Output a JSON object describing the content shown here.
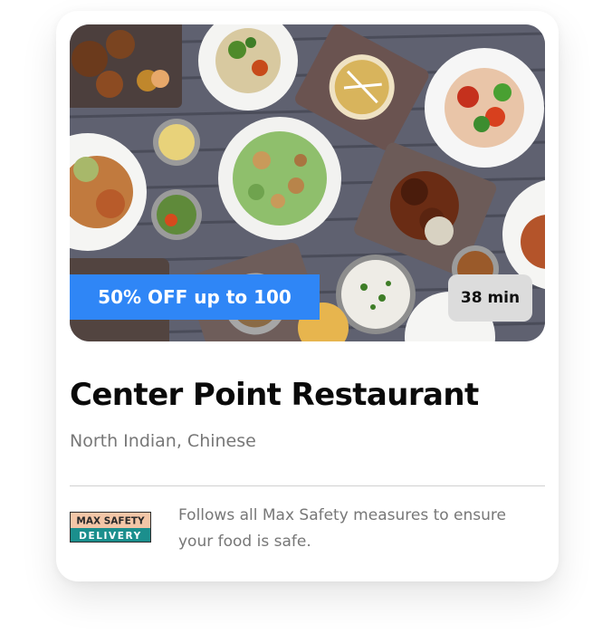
{
  "restaurant": {
    "name": "Center Point Restaurant",
    "cuisines": "North Indian, Chinese"
  },
  "hero": {
    "image_label": "food-spread-photo",
    "offer_text": "50% OFF up to 100",
    "delivery_time": "38 min"
  },
  "safety": {
    "badge_top": "MAX SAFETY",
    "badge_bottom": "DELIVERY",
    "message": "Follows all Max Safety measures to ensure your food is safe."
  },
  "colors": {
    "offer_bg": "#2f86f6",
    "time_bg": "#dcdcdc",
    "badge_top_bg": "#f3c6a7",
    "badge_bottom_bg": "#1b8f8d"
  }
}
